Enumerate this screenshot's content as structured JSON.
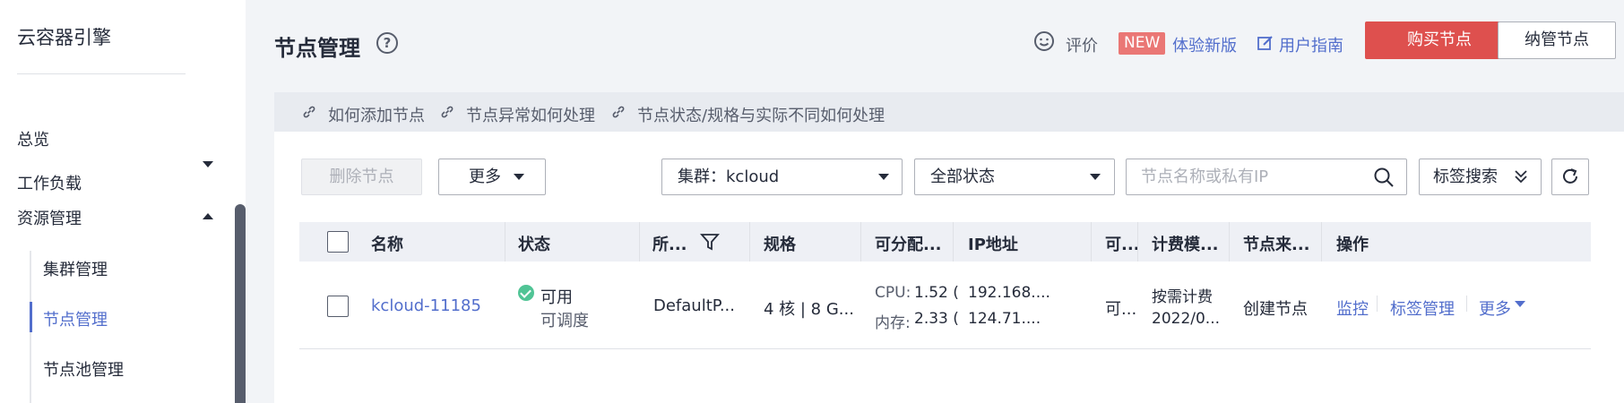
{
  "sidebar": {
    "brand": "云容器引擎",
    "items": [
      {
        "label": "总览"
      },
      {
        "label": "工作负载"
      },
      {
        "label": "资源管理"
      }
    ],
    "sub_items": [
      {
        "label": "集群管理"
      },
      {
        "label": "节点管理"
      },
      {
        "label": "节点池管理"
      }
    ]
  },
  "header": {
    "title": "节点管理",
    "rate_label": "评价",
    "new_badge": "NEW",
    "new_version_label": "体验新版",
    "guide_label": "用户指南",
    "buy_button": "购买节点",
    "manage_button": "纳管节点"
  },
  "help_links": [
    {
      "label": "如何添加节点"
    },
    {
      "label": "节点异常如何处理"
    },
    {
      "label": "节点状态/规格与实际不同如何处理"
    }
  ],
  "toolbar": {
    "delete_label": "删除节点",
    "more_label": "更多",
    "cluster_select": "集群：kcloud",
    "status_select": "全部状态",
    "search_placeholder": "节点名称或私有IP",
    "tag_search_label": "标签搜索"
  },
  "table": {
    "columns": [
      "名称",
      "状态",
      "所...",
      "规格",
      "可分配...",
      "IP地址",
      "可...",
      "计费模...",
      "节点来...",
      "操作"
    ],
    "rows": [
      {
        "name": "kcloud-11185",
        "status": "可用",
        "status_sub": "可调度",
        "pool": "DefaultP...",
        "spec": "4 核 | 8 G...",
        "cpu_label": "CPU:",
        "cpu_value": "1.52 (",
        "mem_label": "内存:",
        "mem_value": "2.33 (",
        "ip1": "192.168....",
        "ip2": "124.71....",
        "az": "可...",
        "billing": "按需计费",
        "billing_date": "2022/0...",
        "source": "创建节点",
        "actions": [
          "监控",
          "标签管理",
          "更多"
        ]
      }
    ]
  },
  "colors": {
    "accent": "#526ecc",
    "primary_button": "#de504e",
    "new_badge": "#ea7775",
    "status_ok": "#50c495"
  }
}
